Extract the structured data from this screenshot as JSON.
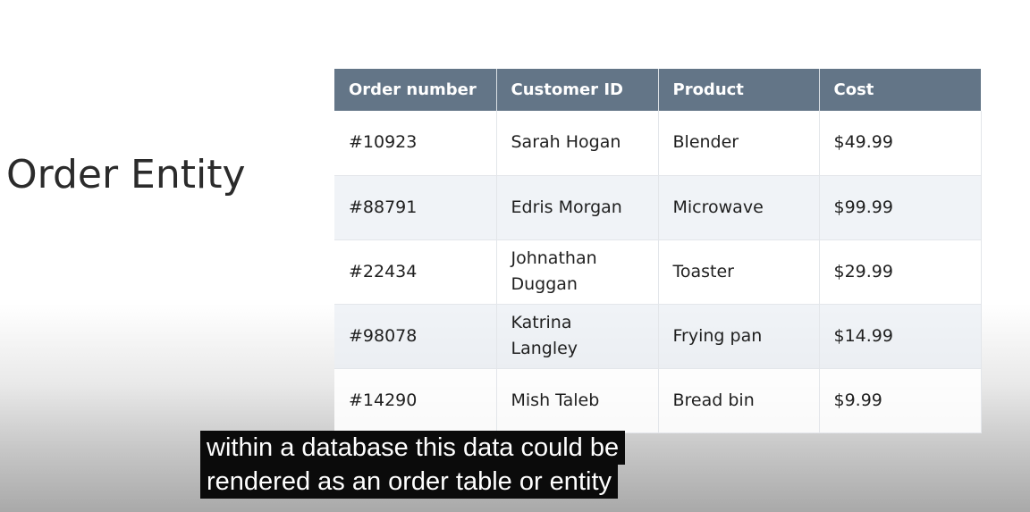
{
  "slide": {
    "title": "Order Entity"
  },
  "table": {
    "headers": [
      "Order number",
      "Customer ID",
      "Product",
      "Cost"
    ],
    "rows": [
      [
        "#10923",
        "Sarah Hogan",
        "Blender",
        "$49.99"
      ],
      [
        "#88791",
        "Edris Morgan",
        "Microwave",
        "$99.99"
      ],
      [
        "#22434",
        "Johnathan Duggan",
        "Toaster",
        "$29.99"
      ],
      [
        "#98078",
        "Katrina Langley",
        "Frying pan",
        "$14.99"
      ],
      [
        "#14290",
        "Mish Taleb",
        "Bread bin",
        "$9.99"
      ]
    ]
  },
  "subtitles": {
    "line1": "within a database this data could be",
    "line2": "rendered as an order table or entity"
  },
  "colors": {
    "header_bg": "#637587",
    "header_text": "#ffffff",
    "alt_row_bg": "#eaeff4",
    "caption_bg": "#0b0b0b"
  }
}
